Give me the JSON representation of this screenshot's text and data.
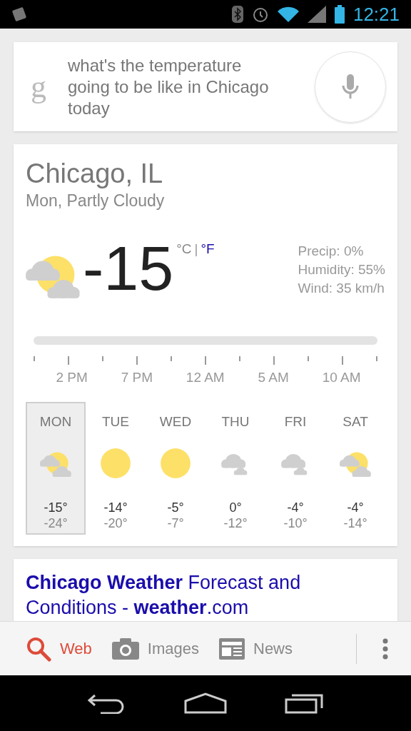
{
  "status_bar": {
    "time": "12:21"
  },
  "search": {
    "logo": "g",
    "query": "what's the temperature going to be like in Chicago today"
  },
  "weather": {
    "location": "Chicago, IL",
    "summary": "Mon, Partly Cloudy",
    "kind": "partly_cloudy",
    "temperature": "-15",
    "units": [
      {
        "label": "°C",
        "selected": true
      },
      {
        "label": "°F",
        "selected": false
      }
    ],
    "unit_separator": "|",
    "details": [
      "Precip: 0%",
      "Humidity: 55%",
      "Wind: 35 km/h"
    ],
    "timeline": [
      "2 PM",
      "7 PM",
      "12 AM",
      "5 AM",
      "10 AM"
    ],
    "days": [
      {
        "day": "MON",
        "kind": "partly_cloudy",
        "high": "-15°",
        "low": "-24°",
        "selected": true
      },
      {
        "day": "TUE",
        "kind": "sunny",
        "high": "-14°",
        "low": "-20°",
        "selected": false
      },
      {
        "day": "WED",
        "kind": "sunny",
        "high": "-5°",
        "low": "-7°",
        "selected": false
      },
      {
        "day": "THU",
        "kind": "cloudy",
        "high": "0°",
        "low": "-12°",
        "selected": false
      },
      {
        "day": "FRI",
        "kind": "cloudy",
        "high": "-4°",
        "low": "-10°",
        "selected": false
      },
      {
        "day": "SAT",
        "kind": "partly_cloudy",
        "high": "-4°",
        "low": "-14°",
        "selected": false
      }
    ]
  },
  "result": {
    "title": "**Chicago Weather** Forecast and Conditions - **weather**.com"
  },
  "tabs": [
    {
      "label": "Web",
      "kind": "web",
      "selected": true
    },
    {
      "label": "Images",
      "kind": "images",
      "selected": false
    },
    {
      "label": "News",
      "kind": "news",
      "selected": false
    }
  ]
}
